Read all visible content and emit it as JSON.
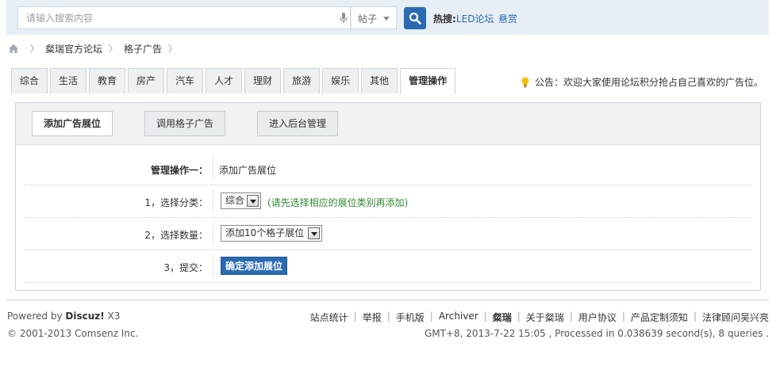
{
  "search": {
    "placeholder": "请输入搜索内容",
    "type_label": "帖子",
    "hot_label": "热搜:",
    "hot_links": [
      "LED论坛",
      "悬赏"
    ]
  },
  "breadcrumb": {
    "items": [
      "粲瑞官方论坛",
      "格子广告"
    ]
  },
  "tabs": [
    {
      "label": "综合"
    },
    {
      "label": "生活"
    },
    {
      "label": "教育"
    },
    {
      "label": "房产"
    },
    {
      "label": "汽车"
    },
    {
      "label": "人才"
    },
    {
      "label": "理财"
    },
    {
      "label": "旅游"
    },
    {
      "label": "娱乐"
    },
    {
      "label": "其他"
    },
    {
      "label": "管理操作",
      "active": true
    }
  ],
  "notice": "公告：欢迎大家使用论坛积分抢占自己喜欢的广告位。",
  "panel": {
    "buttons": [
      "添加广告展位",
      "调用格子广告",
      "进入后台管理"
    ],
    "rows": {
      "title_label": "管理操作一：",
      "title_value": "添加广告展位",
      "category_label": "1，选择分类：",
      "category_value": "综合",
      "category_hint": "(请先选择相应的展位类别再添加)",
      "quantity_label": "2，选择数量：",
      "quantity_value": "添加10个格子展位",
      "submit_label": "3，提交：",
      "submit_button": "确定添加展位"
    }
  },
  "footer": {
    "powered_prefix": "Powered by ",
    "powered_brand": "Discuz!",
    "powered_version": " X3",
    "copyright": "© 2001-2013 Comsenz Inc.",
    "links": [
      "站点统计",
      "举报",
      "手机版",
      "Archiver",
      "粲瑞",
      "关于粲瑞",
      "用户协议",
      "产品定制须知",
      "法律顾问吴兴亮"
    ],
    "stats": "GMT+8, 2013-7-22 15:05 , Processed in 0.038639 second(s), 8 queries ."
  },
  "colors": {
    "accent": "#2a6ab3",
    "hint_green": "#2f8a2f",
    "topbar_bg": "#e8eef5"
  }
}
